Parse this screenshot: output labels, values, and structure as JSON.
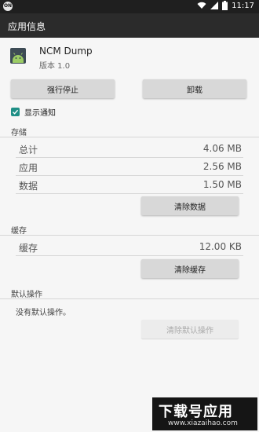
{
  "status_bar": {
    "left_badge": "ON",
    "time": "11:17",
    "icons": [
      "notification-badge-icon",
      "wifi-icon",
      "signal-icon",
      "battery-icon"
    ]
  },
  "app_bar": {
    "title": "应用信息"
  },
  "app": {
    "name": "NCM Dump",
    "version": "版本 1.0",
    "icon": "android-icon"
  },
  "actions": {
    "force_stop": "强行停止",
    "uninstall": "卸载"
  },
  "notifications": {
    "label": "显示通知",
    "checked": true
  },
  "storage": {
    "title": "存储",
    "rows": [
      {
        "label": "总计",
        "value": "4.06 MB"
      },
      {
        "label": "应用",
        "value": "2.56 MB"
      },
      {
        "label": "数据",
        "value": "1.50 MB"
      }
    ],
    "clear_data": "清除数据"
  },
  "cache": {
    "title": "缓存",
    "rows": [
      {
        "label": "缓存",
        "value": "12.00 KB"
      }
    ],
    "clear_cache": "清除缓存"
  },
  "defaults": {
    "title": "默认操作",
    "text": "没有默认操作。",
    "clear_defaults": "清除默认操作"
  },
  "watermark": {
    "main": "下载号应用",
    "sub": "www.xiazaihao.com"
  },
  "colors": {
    "status_bar": "#1f1f1f",
    "app_bar": "#2b2b2b",
    "accent": "#1f8f86",
    "background": "#f6f6f6"
  }
}
